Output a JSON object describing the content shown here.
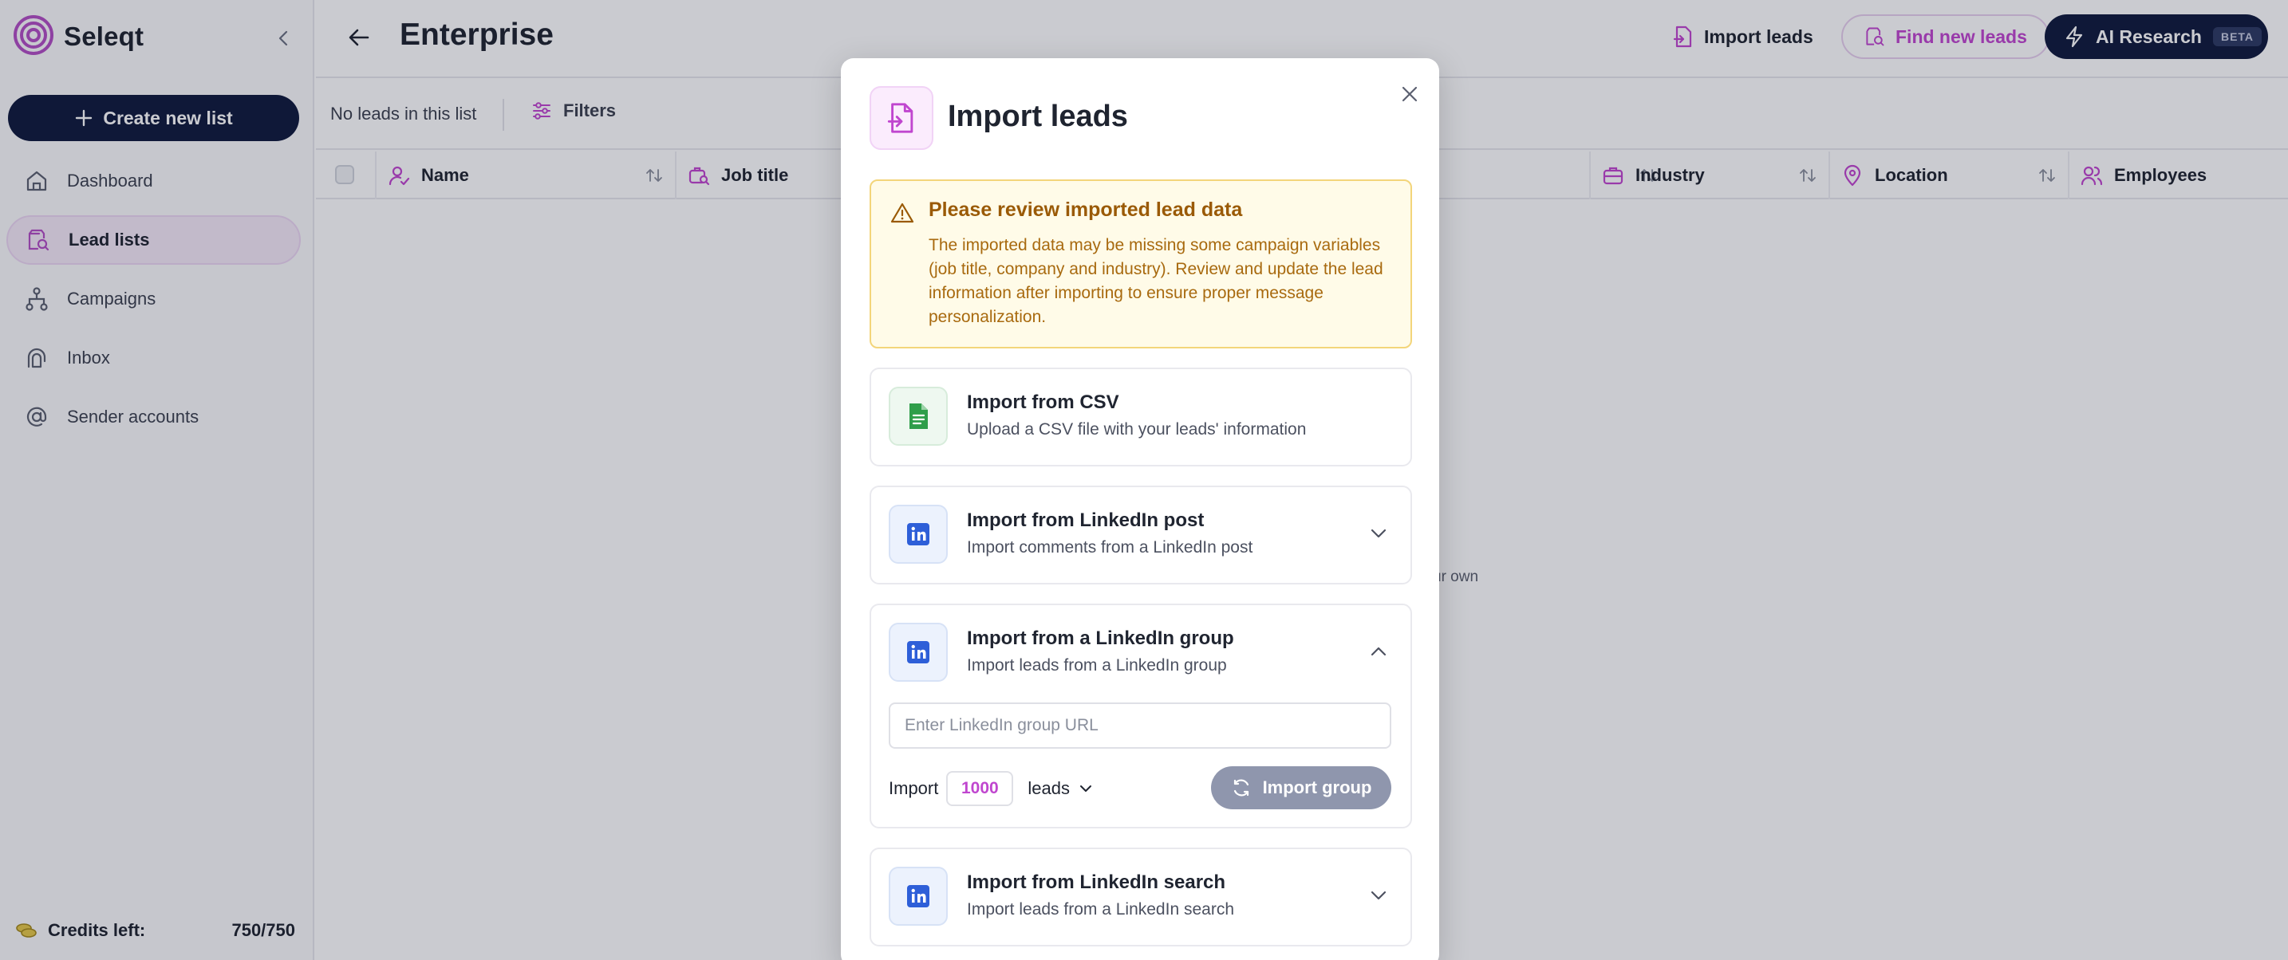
{
  "app": {
    "name": "Seleqt"
  },
  "sidebar": {
    "create_label": "Create new list",
    "items": [
      {
        "label": "Dashboard",
        "icon": "home-icon",
        "active": false
      },
      {
        "label": "Lead lists",
        "icon": "lead-list-icon",
        "active": true
      },
      {
        "label": "Campaigns",
        "icon": "campaigns-icon",
        "active": false
      },
      {
        "label": "Inbox",
        "icon": "inbox-icon",
        "active": false
      },
      {
        "label": "Sender accounts",
        "icon": "at-icon",
        "active": false
      }
    ],
    "credits_label": "Credits left:",
    "credits_value": "750/750"
  },
  "header": {
    "title": "Enterprise",
    "import_label": "Import leads",
    "find_label": "Find new leads",
    "ai_label": "AI Research",
    "ai_badge": "BETA"
  },
  "toolbar": {
    "status": "No leads in this list",
    "filters_label": "Filters"
  },
  "table": {
    "columns": [
      "Name",
      "Job title",
      "Industry",
      "Location",
      "Employees"
    ]
  },
  "background_hint": "ur own",
  "modal": {
    "title": "Import leads",
    "warning": {
      "title": "Please review imported lead data",
      "text": "The imported data may be missing some campaign variables (job title, company and industry). Review and update the lead information after importing to ensure proper message personalization."
    },
    "options": [
      {
        "title": "Import from CSV",
        "subtitle": "Upload a CSV file with your leads' information"
      },
      {
        "title": "Import from LinkedIn post",
        "subtitle": "Import comments from a LinkedIn post"
      },
      {
        "title": "Import from a LinkedIn group",
        "subtitle": "Import leads from a LinkedIn group"
      },
      {
        "title": "Import from LinkedIn search",
        "subtitle": "Import leads from a LinkedIn search"
      }
    ],
    "group_form": {
      "url_placeholder": "Enter LinkedIn group URL",
      "import_label": "Import",
      "count": "1000",
      "leads_label": "leads",
      "button_label": "Import group"
    }
  },
  "colors": {
    "navy": "#101a3d",
    "accent_pink": "#c046cf",
    "warning_text": "#9a5a06",
    "linkedin_blue": "#2e5fd8",
    "csv_green": "#2f9e4a"
  }
}
